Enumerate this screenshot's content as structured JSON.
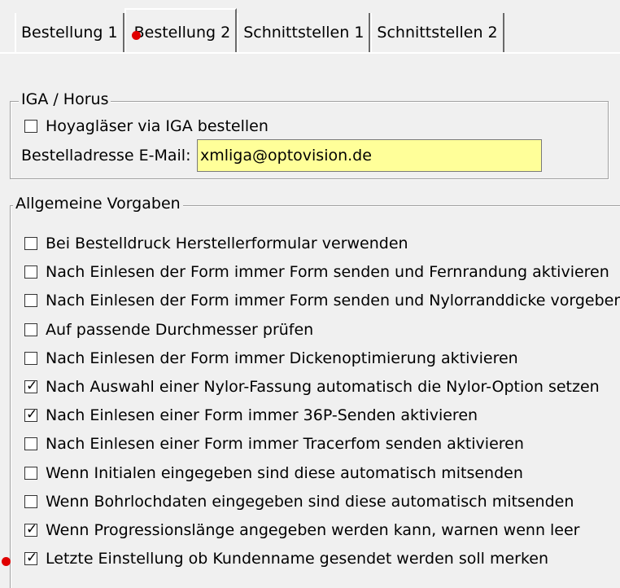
{
  "tabs": [
    {
      "label": "Bestellung 1",
      "active": false
    },
    {
      "label": "Bestellung 2",
      "active": true
    },
    {
      "label": "Schnittstellen 1",
      "active": false
    },
    {
      "label": "Schnittstellen 2",
      "active": false
    }
  ],
  "iga_group": {
    "title": "IGA / Horus",
    "hoya_checkbox": {
      "label": "Hoyagläser via IGA bestellen",
      "checked": false
    },
    "email_label": "Bestelladresse E-Mail:",
    "email_value": "xmliga@optovision.de"
  },
  "general_group": {
    "title": "Allgemeine Vorgaben",
    "options": [
      {
        "label": "Bei Bestelldruck Herstellerformular verwenden",
        "checked": false
      },
      {
        "label": "Nach Einlesen der Form immer Form senden und Fernrandung aktivieren",
        "checked": false
      },
      {
        "label": "Nach Einlesen der Form immer Form senden und Nylorranddicke vorgeben",
        "checked": false
      },
      {
        "label": "Auf passende Durchmesser prüfen",
        "checked": false
      },
      {
        "label": "Nach Einlesen der Form immer Dickenoptimierung aktivieren",
        "checked": false
      },
      {
        "label": "Nach Auswahl einer Nylor-Fassung automatisch die Nylor-Option setzen",
        "checked": true
      },
      {
        "label": "Nach Einlesen einer Form immer 36P-Senden aktivieren",
        "checked": true
      },
      {
        "label": "Nach Einlesen einer Form immer Tracerfom senden aktivieren",
        "checked": false
      },
      {
        "label": "Wenn Initialen eingegeben sind diese automatisch mitsenden",
        "checked": false
      },
      {
        "label": "Wenn Bohrlochdaten eingegeben sind diese automatisch mitsenden",
        "checked": false
      },
      {
        "label": "Wenn Progressionslänge angegeben werden kann, warnen wenn leer",
        "checked": true
      },
      {
        "label": "Letzte Einstellung ob Kundenname gesendet werden soll merken",
        "checked": true
      }
    ]
  },
  "colors": {
    "input_bg": "#ffff99",
    "marker": "#e00000",
    "background": "#f0f0f0"
  }
}
